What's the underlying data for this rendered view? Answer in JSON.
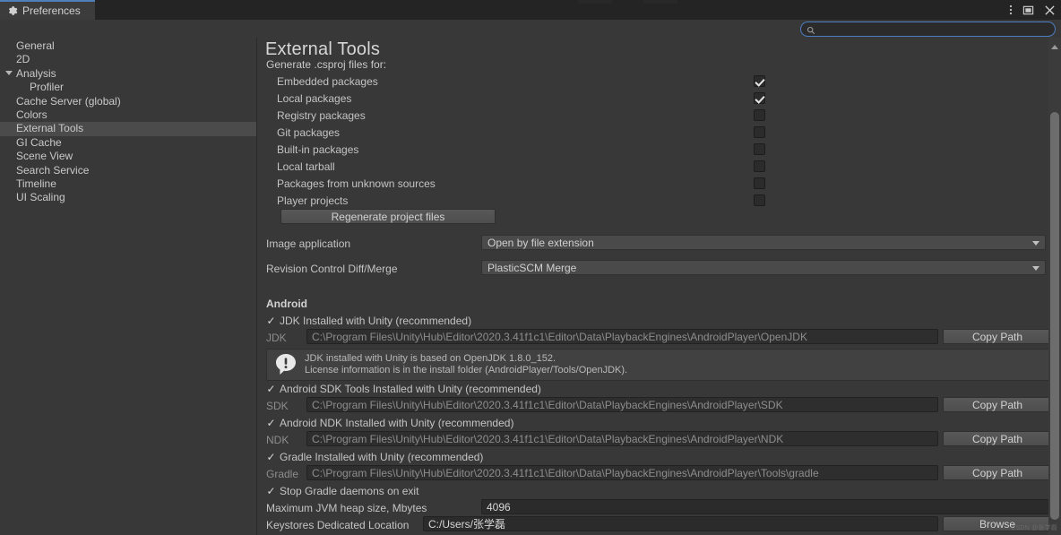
{
  "window": {
    "tab_title": "Preferences",
    "tab_icon": "gear-icon",
    "menu_icon": "kebab-menu-icon",
    "maximize_icon": "maximize-icon",
    "close_icon": "close-icon"
  },
  "search": {
    "value": "",
    "placeholder": "",
    "icon": "search-icon"
  },
  "sidebar": {
    "items": [
      {
        "label": "General",
        "indent": false,
        "expandable": false,
        "selected": false
      },
      {
        "label": "2D",
        "indent": false,
        "expandable": false,
        "selected": false
      },
      {
        "label": "Analysis",
        "indent": false,
        "expandable": true,
        "selected": false
      },
      {
        "label": "Profiler",
        "indent": true,
        "expandable": false,
        "selected": false
      },
      {
        "label": "Cache Server (global)",
        "indent": false,
        "expandable": false,
        "selected": false
      },
      {
        "label": "Colors",
        "indent": false,
        "expandable": false,
        "selected": false
      },
      {
        "label": "External Tools",
        "indent": false,
        "expandable": false,
        "selected": true
      },
      {
        "label": "GI Cache",
        "indent": false,
        "expandable": false,
        "selected": false
      },
      {
        "label": "Scene View",
        "indent": false,
        "expandable": false,
        "selected": false
      },
      {
        "label": "Search Service",
        "indent": false,
        "expandable": false,
        "selected": false
      },
      {
        "label": "Timeline",
        "indent": false,
        "expandable": false,
        "selected": false
      },
      {
        "label": "UI Scaling",
        "indent": false,
        "expandable": false,
        "selected": false
      }
    ]
  },
  "content": {
    "title": "External Tools",
    "csproj": {
      "group_label": "Generate .csproj files for:",
      "options": [
        {
          "label": "Embedded packages",
          "checked": true
        },
        {
          "label": "Local packages",
          "checked": true
        },
        {
          "label": "Registry packages",
          "checked": false
        },
        {
          "label": "Git packages",
          "checked": false
        },
        {
          "label": "Built-in packages",
          "checked": false
        },
        {
          "label": "Local tarball",
          "checked": false
        },
        {
          "label": "Packages from unknown sources",
          "checked": false
        },
        {
          "label": "Player projects",
          "checked": false
        }
      ],
      "regenerate_button": "Regenerate project files"
    },
    "image_application": {
      "label": "Image application",
      "value": "Open by file extension"
    },
    "revision_control": {
      "label": "Revision Control Diff/Merge",
      "value": "PlasticSCM Merge"
    },
    "android": {
      "heading": "Android",
      "jdk": {
        "toggle_label": "JDK Installed with Unity (recommended)",
        "toggle_checked": true,
        "field_label": "JDK",
        "path": "C:\\Program Files\\Unity\\Hub\\Editor\\2020.3.41f1c1\\Editor\\Data\\PlaybackEngines\\AndroidPlayer\\OpenJDK",
        "copy_button": "Copy Path"
      },
      "help": {
        "icon": "info-speech-bubble-icon",
        "line1": "JDK installed with Unity is based on OpenJDK 1.8.0_152.",
        "line2": "License information is in the install folder (AndroidPlayer/Tools/OpenJDK)."
      },
      "sdk": {
        "toggle_label": "Android SDK Tools Installed with Unity (recommended)",
        "toggle_checked": true,
        "field_label": "SDK",
        "path": "C:\\Program Files\\Unity\\Hub\\Editor\\2020.3.41f1c1\\Editor\\Data\\PlaybackEngines\\AndroidPlayer\\SDK",
        "copy_button": "Copy Path"
      },
      "ndk": {
        "toggle_label": "Android NDK Installed with Unity (recommended)",
        "toggle_checked": true,
        "field_label": "NDK",
        "path": "C:\\Program Files\\Unity\\Hub\\Editor\\2020.3.41f1c1\\Editor\\Data\\PlaybackEngines\\AndroidPlayer\\NDK",
        "copy_button": "Copy Path"
      },
      "gradle": {
        "toggle_label": "Gradle Installed with Unity (recommended)",
        "toggle_checked": true,
        "field_label": "Gradle",
        "path": "C:\\Program Files\\Unity\\Hub\\Editor\\2020.3.41f1c1\\Editor\\Data\\PlaybackEngines\\AndroidPlayer\\Tools\\gradle",
        "copy_button": "Copy Path"
      },
      "stop_gradle": {
        "label": "Stop Gradle daemons on exit",
        "checked": true
      },
      "jvm_heap": {
        "label": "Maximum JVM heap size, Mbytes",
        "value": "4096"
      },
      "keystores": {
        "label": "Keystores Dedicated Location",
        "value": "C:/Users/张学磊",
        "browse_button": "Browse"
      }
    }
  },
  "watermark": "CSDN @张学磊",
  "colors": {
    "window_bg": "#383838",
    "titlebar_bg": "#242424",
    "tab_accent": "#4f7fb8",
    "selection": "#4b4b4b",
    "field_bg": "#2e2e2e",
    "button_bg": "#4e4e4e",
    "search_focus_border": "#4b7ec1",
    "text": "#c9c9c9",
    "dim_text": "#8d8d8d"
  }
}
